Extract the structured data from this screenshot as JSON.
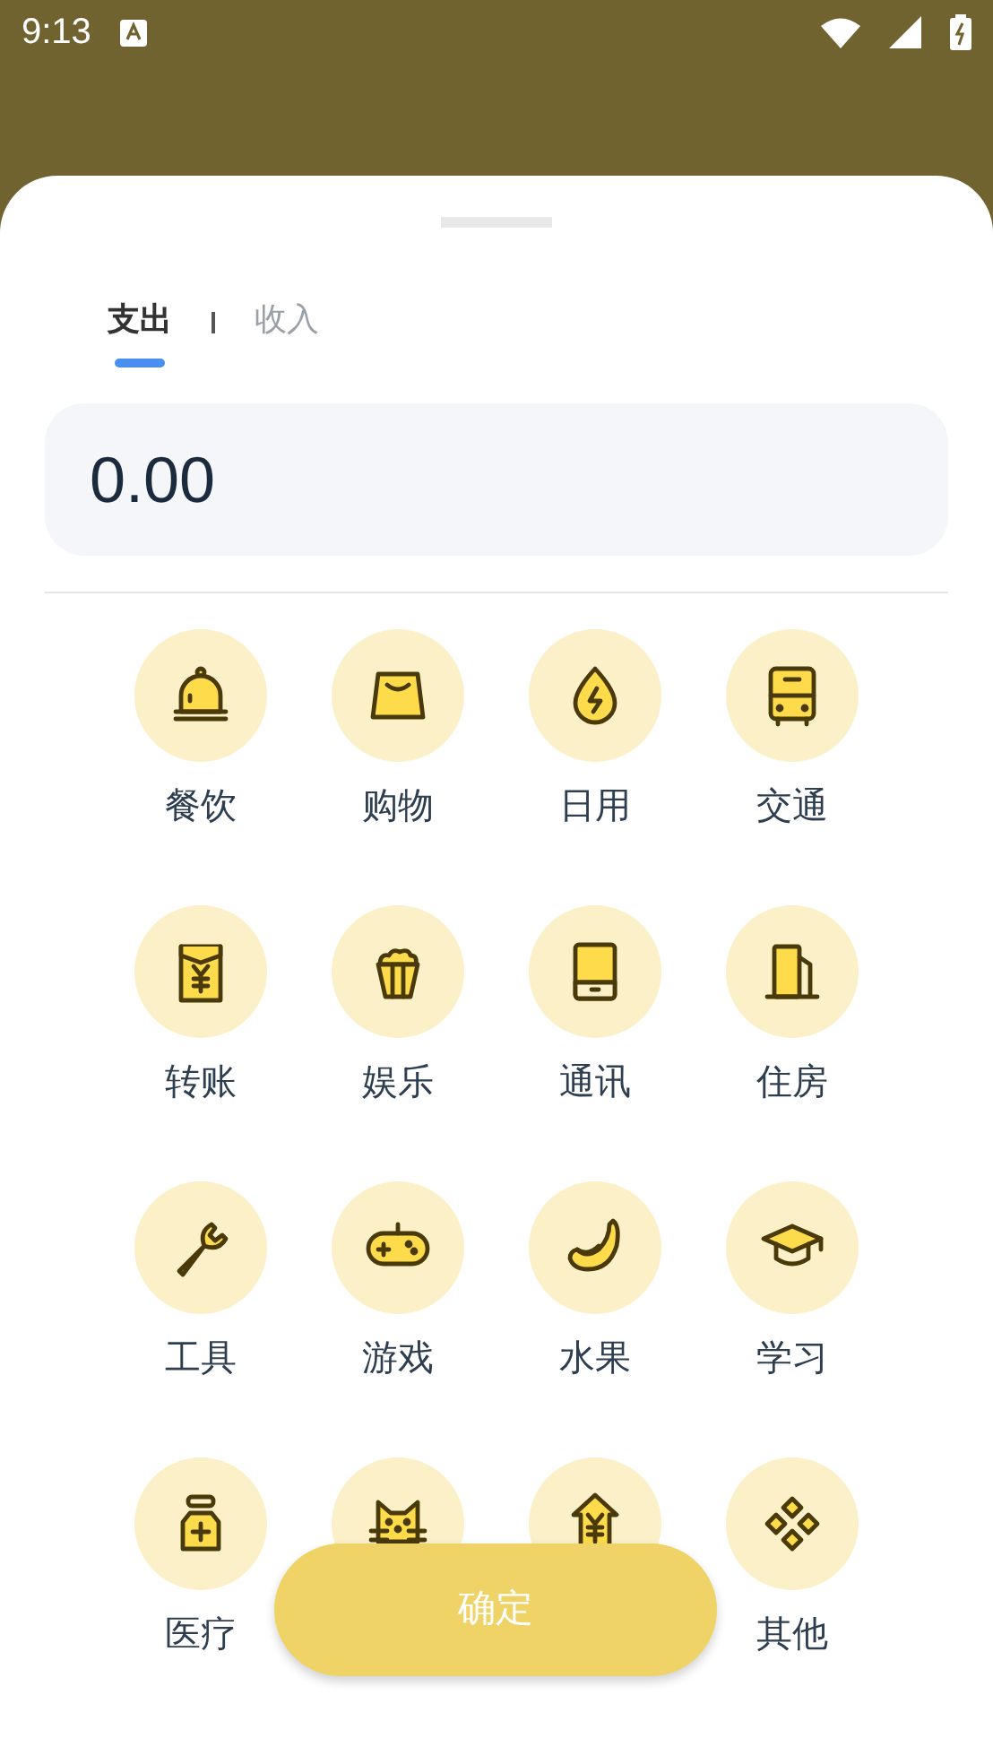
{
  "status_bar": {
    "time": "9:13"
  },
  "tabs": [
    {
      "label": "支出",
      "selected": true
    },
    {
      "label": "收入",
      "selected": false
    }
  ],
  "amount": "0.00",
  "categories": [
    {
      "kind": "full",
      "label": "餐饮"
    },
    {
      "kind": "full",
      "label": "购物"
    },
    {
      "kind": "full",
      "label": "日用"
    },
    {
      "kind": "full",
      "label": "交通"
    },
    {
      "kind": "full",
      "label": "转账"
    },
    {
      "kind": "full",
      "label": "娱乐"
    },
    {
      "kind": "full",
      "label": "通讯"
    },
    {
      "kind": "full",
      "label": "住房"
    },
    {
      "kind": "full",
      "label": "工具"
    },
    {
      "kind": "full",
      "label": "游戏"
    },
    {
      "kind": "full",
      "label": "水果"
    },
    {
      "kind": "full",
      "label": "学习"
    },
    {
      "kind": "full",
      "label": "医疗"
    },
    {
      "kind": "covered"
    },
    {
      "kind": "covered"
    },
    {
      "kind": "full",
      "label": "其他"
    }
  ],
  "confirm_button": "确定"
}
